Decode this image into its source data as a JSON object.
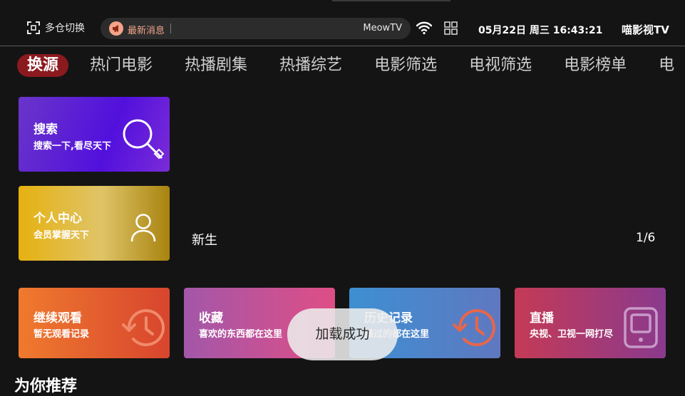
{
  "header": {
    "switch_label": "多仓切换",
    "news_label": "最新消息",
    "news_brand": "MeowTV",
    "datetime": "05月22日 周三 16:43:21",
    "app_name": "喵影视TV"
  },
  "tabs": [
    {
      "label": "换源",
      "active": true
    },
    {
      "label": "热门电影"
    },
    {
      "label": "热播剧集"
    },
    {
      "label": "热播综艺"
    },
    {
      "label": "电影筛选"
    },
    {
      "label": "电视筛选"
    },
    {
      "label": "电影榜单"
    },
    {
      "label": "电"
    }
  ],
  "cards": {
    "search": {
      "title": "搜索",
      "subtitle": "搜索一下,看尽天下"
    },
    "user": {
      "title": "个人中心",
      "subtitle": "会员掌握天下"
    },
    "continue": {
      "title": "继续观看",
      "subtitle": "暂无观看记录"
    },
    "favorites": {
      "title": "收藏",
      "subtitle": "喜欢的东西都在这里"
    },
    "history": {
      "title": "历史记录",
      "subtitle": "播过的都在这里"
    },
    "live": {
      "title": "直播",
      "subtitle": "央视、卫视一网打尽"
    }
  },
  "banner": {
    "title": "新生",
    "page": "1/6"
  },
  "toast": "加载成功",
  "section_title": "为你推荐",
  "colors": {
    "accent": "#8b1a1f",
    "background": "#141414",
    "news_text": "#f0a48a"
  }
}
